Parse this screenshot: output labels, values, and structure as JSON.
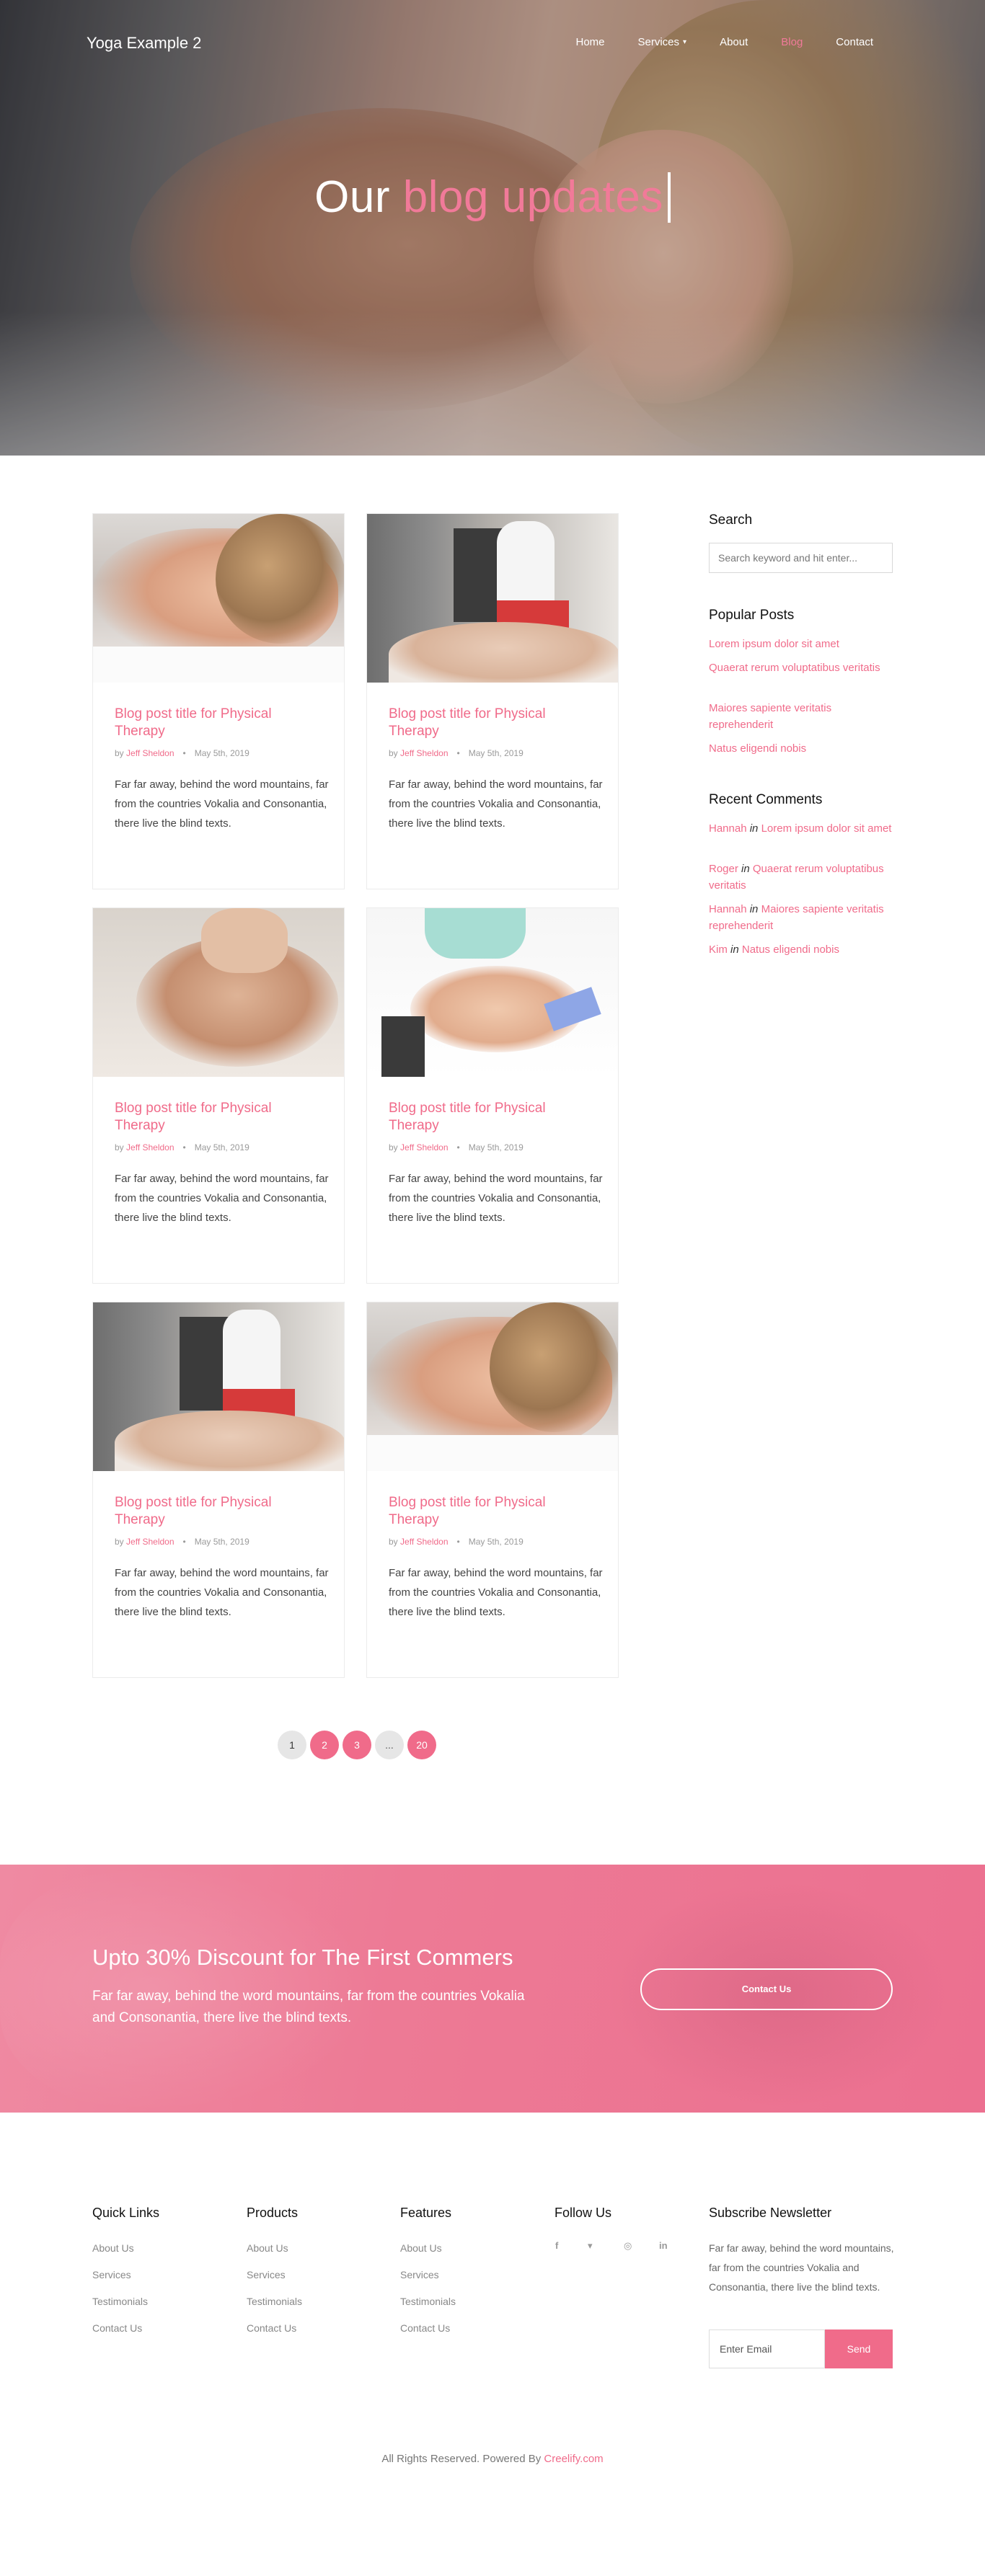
{
  "brand": "Yoga Example 2",
  "nav": [
    {
      "label": "Home"
    },
    {
      "label": "Services",
      "has_dropdown": true
    },
    {
      "label": "About"
    },
    {
      "label": "Blog",
      "active": true
    },
    {
      "label": "Contact"
    }
  ],
  "hero": {
    "title_white": "Our",
    "title_pink": "blog updates"
  },
  "posts": [
    {
      "title": "Blog post title for Physical Therapy",
      "by": "by",
      "author": "Jeff Sheldon",
      "sep": "•",
      "date": "May 5th, 2019",
      "excerpt": "Far far away, behind the word mountains, far from the countries Vokalia and Consonantia, there live the blind texts.",
      "image": "woman-massage-photo"
    },
    {
      "title": "Blog post title for Physical Therapy",
      "by": "by",
      "author": "Jeff Sheldon",
      "sep": "•",
      "date": "May 5th, 2019",
      "excerpt": "Far far away, behind the word mountains, far from the countries Vokalia and Consonantia, there live the blind texts.",
      "image": "therapist-photo"
    },
    {
      "title": "Blog post title for Physical Therapy",
      "by": "by",
      "author": "Jeff Sheldon",
      "sep": "•",
      "date": "May 5th, 2019",
      "excerpt": "Far far away, behind the word mountains, far from the countries Vokalia and Consonantia, there live the blind texts.",
      "image": "back-massage-photo"
    },
    {
      "title": "Blog post title for Physical Therapy",
      "by": "by",
      "author": "Jeff Sheldon",
      "sep": "•",
      "date": "May 5th, 2019",
      "excerpt": "Far far away, behind the word mountains, far from the countries Vokalia and Consonantia, there live the blind texts.",
      "image": "knee-therapy-photo"
    },
    {
      "title": "Blog post title for Physical Therapy",
      "by": "by",
      "author": "Jeff Sheldon",
      "sep": "•",
      "date": "May 5th, 2019",
      "excerpt": "Far far away, behind the word mountains, far from the countries Vokalia and Consonantia, there live the blind texts.",
      "image": "therapist-photo"
    },
    {
      "title": "Blog post title for Physical Therapy",
      "by": "by",
      "author": "Jeff Sheldon",
      "sep": "•",
      "date": "May 5th, 2019",
      "excerpt": "Far far away, behind the word mountains, far from the countries Vokalia and Consonantia, there live the blind texts.",
      "image": "woman-massage-photo"
    }
  ],
  "sidebar": {
    "search_title": "Search",
    "search_placeholder": "Search keyword and hit enter...",
    "popular_title": "Popular Posts",
    "popular": [
      "Lorem ipsum dolor sit amet",
      "Quaerat rerum voluptatibus veritatis",
      "Maiores sapiente veritatis reprehenderit",
      "Natus eligendi nobis"
    ],
    "comments_title": "Recent Comments",
    "comments": [
      {
        "who": "Hannah",
        "in": "in",
        "post": "Lorem ipsum dolor sit amet"
      },
      {
        "who": "Roger",
        "in": "in",
        "post": "Quaerat rerum voluptatibus veritatis"
      },
      {
        "who": "Hannah",
        "in": "in",
        "post": "Maiores sapiente veritatis reprehenderit"
      },
      {
        "who": "Kim",
        "in": "in",
        "post": "Natus eligendi nobis"
      }
    ]
  },
  "pagination": [
    "1",
    "2",
    "3",
    "...",
    "20"
  ],
  "promo": {
    "title": "Upto 30% Discount for The First Commers",
    "text": "Far far away, behind the word mountains, far from the countries Vokalia and Consonantia, there live the blind texts.",
    "button": "Contact Us"
  },
  "footer": {
    "quick_links_title": "Quick Links",
    "quick_links": [
      "About Us",
      "Services",
      "Testimonials",
      "Contact Us"
    ],
    "products_title": "Products",
    "products": [
      "About Us",
      "Services",
      "Testimonials",
      "Contact Us"
    ],
    "features_title": "Features",
    "features": [
      "About Us",
      "Services",
      "Testimonials",
      "Contact Us"
    ],
    "follow_title": "Follow Us",
    "social": [
      {
        "icon": "facebook-icon",
        "glyph": "f"
      },
      {
        "icon": "twitter-icon",
        "glyph": "▾"
      },
      {
        "icon": "instagram-icon",
        "glyph": "◎"
      },
      {
        "icon": "linkedin-icon",
        "glyph": "in"
      }
    ],
    "newsletter_title": "Subscribe Newsletter",
    "newsletter_text": "Far far away, behind the word mountains, far from the countries Vokalia and Consonantia, there live the blind texts.",
    "email_placeholder": "Enter Email",
    "send": "Send",
    "copyright_prefix": "All Rights Reserved. Powered By",
    "copyright_link": "Creelify.com"
  },
  "colors": {
    "accent": "#f06b8a",
    "promo": "#ec7690"
  }
}
